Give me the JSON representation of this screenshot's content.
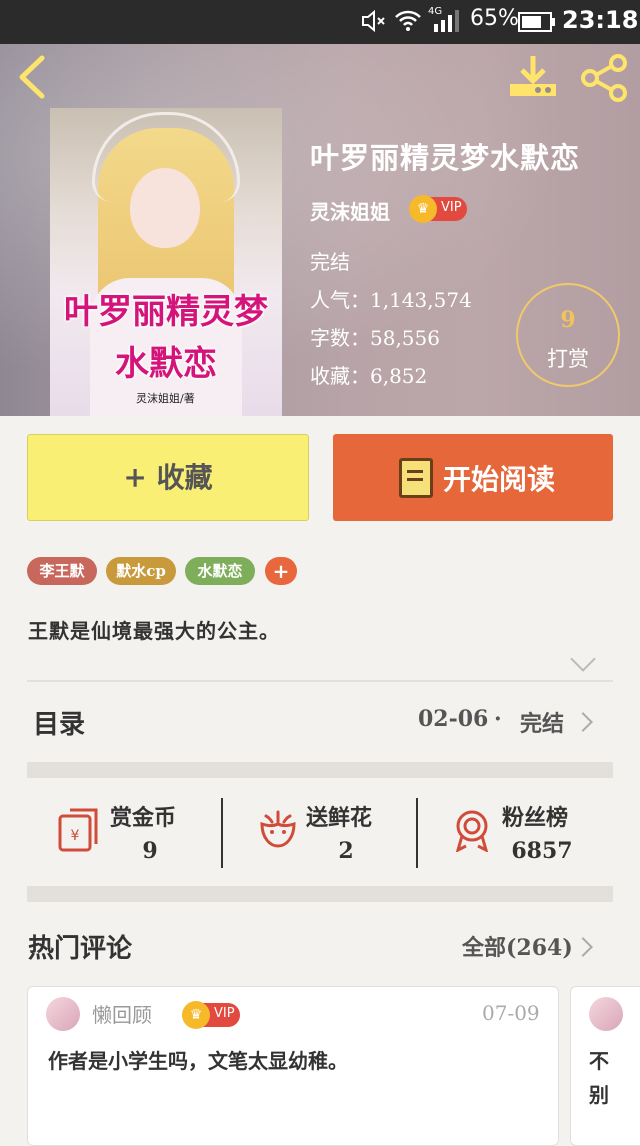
{
  "status_bar": {
    "battery": "65%",
    "time": "23:18",
    "network": "4G"
  },
  "book": {
    "title": "叶罗丽精灵梦水默恋",
    "author": "灵沫姐姐",
    "vip": "VIP",
    "status": "完结",
    "cover_title_line1": "叶罗丽精灵梦",
    "cover_title_line2": "水默恋",
    "cover_author": "灵沫姐姐/著",
    "popularity_label": "人气：",
    "popularity": "1,143,574",
    "words_label": "字数：",
    "words": "58,556",
    "collections_label": "收藏：",
    "collections": "6,852"
  },
  "reward": {
    "count": "9",
    "label": "打赏"
  },
  "actions": {
    "collect": "+ 收藏",
    "read": "开始阅读"
  },
  "tags": [
    {
      "label": "李王默",
      "color": "#c8675c"
    },
    {
      "label": "默水cp",
      "color": "#c89a3c"
    },
    {
      "label": "水默恋",
      "color": "#7eae5a"
    },
    {
      "label": "+",
      "color": "#e8673c"
    }
  ],
  "intro": "王默是仙境最强大的公主。",
  "toc": {
    "title": "目录",
    "date": "02-06",
    "dot": "·",
    "status": "完结"
  },
  "gifts": [
    {
      "label": "赏金币",
      "value": "9"
    },
    {
      "label": "送鲜花",
      "value": "2"
    },
    {
      "label": "粉丝榜",
      "value": "6857"
    }
  ],
  "comments_section": {
    "title": "热门评论",
    "all_label": "全部(264)"
  },
  "comments": [
    {
      "user": "懒回顾",
      "vip": "VIP",
      "date": "07-09",
      "text": "作者是小学生吗，文笔太显幼稚。"
    },
    {
      "text_partial_1": "不",
      "text_partial_2": "别"
    }
  ],
  "colors": {
    "accent_orange": "#e5673a",
    "collect_yellow": "#f9ef74",
    "vip_red": "#e2493f"
  }
}
